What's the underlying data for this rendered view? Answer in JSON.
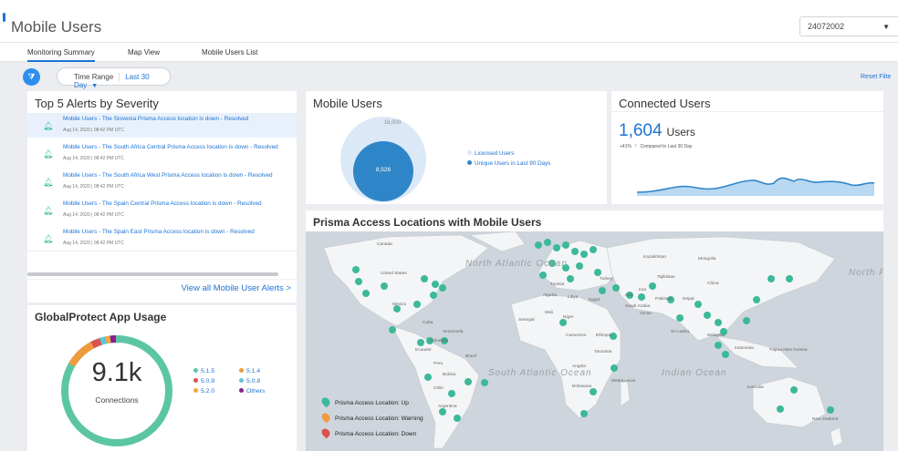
{
  "header": {
    "title": "Mobile Users",
    "tenant_id": "24072002"
  },
  "tabs": [
    {
      "label": "Monitoring Summary",
      "active": true
    },
    {
      "label": "Map View",
      "active": false
    },
    {
      "label": "Mobile Users List",
      "active": false
    }
  ],
  "filters": {
    "time_range_label": "Time Range",
    "time_range_value": "Last 30 Day",
    "reset_label": "Reset Filte"
  },
  "alerts": {
    "title": "Top 5 Alerts by Severity",
    "items": [
      {
        "text": "Mobile Users - The Slovenia Prisma Access location is down - Resolved",
        "time": "Aug 14, 2020 | 08:42 PM UTC",
        "selected": true
      },
      {
        "text": "Mobile Users - The South Africa Central Prisma Access location is down - Resolved",
        "time": "Aug 14, 2020 | 08:42 PM UTC",
        "selected": false
      },
      {
        "text": "Mobile Users - The South Africa West Prisma Access location is down - Resolved",
        "time": "Aug 14, 2020 | 08:42 PM UTC",
        "selected": false
      },
      {
        "text": "Mobile Users - The Spain Central Prisma Access location is down - Resolved",
        "time": "Aug 14, 2020 | 08:42 PM UTC",
        "selected": false
      },
      {
        "text": "Mobile Users - The Spain East Prisma Access location is down - Resolved",
        "time": "Aug 14, 2020 | 08:42 PM UTC",
        "selected": false
      }
    ],
    "view_all": "View all Mobile User Alerts >"
  },
  "mobile_users": {
    "title": "Mobile Users",
    "licensed_value": "16,000",
    "unique_value": "8,526",
    "legend": [
      "Licensed Users",
      "Unique Users in Last 90 Days"
    ]
  },
  "connected_users": {
    "title": "Connected Users",
    "count": "1,604",
    "unit": "Users",
    "change_pct": "+41%",
    "change_note": "Compared to Last 30 Day"
  },
  "app_usage": {
    "title": "GlobalProtect App Usage",
    "total": "9.1k",
    "total_label": "Connections",
    "versions": [
      {
        "name": "5.1.5",
        "color": "#5cc6a4"
      },
      {
        "name": "5.1.4",
        "color": "#f09a3e"
      },
      {
        "name": "5.0.9",
        "color": "#d9534f"
      },
      {
        "name": "5.0.8",
        "color": "#60c3d9"
      },
      {
        "name": "5.2.0",
        "color": "#f2a93b"
      },
      {
        "name": "Others",
        "color": "#8b1d8e"
      }
    ]
  },
  "map": {
    "title": "Prisma Access Locations with Mobile Users",
    "legend": [
      {
        "label": "Prisma Access Location: Up",
        "color": "#3bb99a"
      },
      {
        "label": "Prisma Access Location: Warning",
        "color": "#f09a3e"
      },
      {
        "label": "Prisma Access Location: Down",
        "color": "#d9534f"
      }
    ],
    "oceans": [
      "North Atlantic Ocean",
      "North Pacific Ocea",
      "South Atlantic Ocean",
      "Indian Ocean"
    ],
    "regions": [
      "Canada",
      "United States",
      "Mexico",
      "Cuba",
      "Venezuela",
      "Colombia",
      "Ecuador",
      "Peru",
      "Brazil",
      "Bolivia",
      "Chile",
      "Argentina",
      "Algeria",
      "Libya",
      "Egypt",
      "Tunisia",
      "Mali",
      "Niger",
      "Senegal",
      "Cameroon",
      "Ethiopia",
      "Tanzania",
      "Angola",
      "Botswana",
      "Madagascar",
      "Turkey",
      "Iran",
      "Iraq",
      "Saudi Arabia",
      "Oman",
      "Pakistan",
      "Nepal",
      "Kazakhstan",
      "Mongolia",
      "China",
      "Tajikistan",
      "Sri Lanka",
      "Malaysia",
      "Indonesia",
      "Papua New Guinea",
      "Australia",
      "New Zealand"
    ]
  }
}
